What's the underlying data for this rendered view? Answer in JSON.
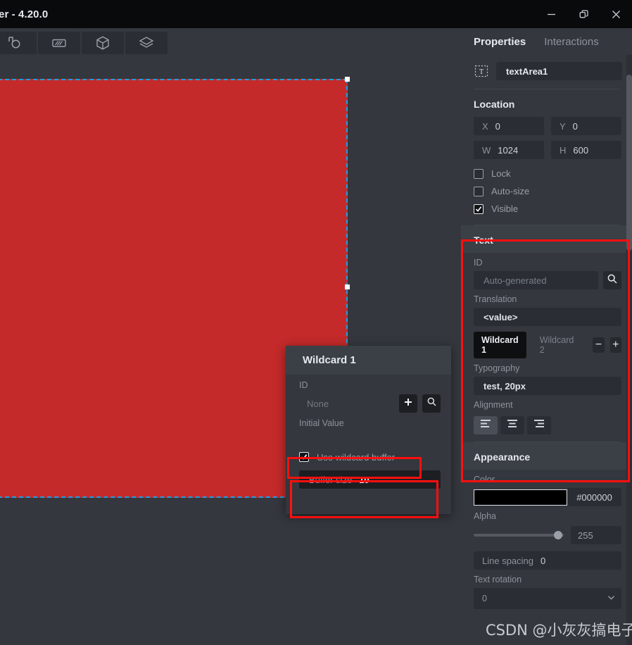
{
  "window": {
    "title": "er - 4.20.0",
    "controls": {
      "minimize": "minimize-icon",
      "restore": "restore-icon",
      "close": "close-icon"
    }
  },
  "toolbar": {
    "buttons": [
      {
        "name": "shape-tool-icon",
        "label": ""
      },
      {
        "name": "image-tool-icon",
        "label": ""
      },
      {
        "name": "box-tool-icon",
        "label": ""
      },
      {
        "name": "layers-tool-icon",
        "label": ""
      }
    ]
  },
  "canvas": {
    "selection": {
      "fill_color": "#c42a2a",
      "border_color": "#1f9fe0"
    }
  },
  "properties": {
    "tabs": [
      {
        "label": "Properties",
        "active": true
      },
      {
        "label": "Interactions",
        "active": false
      }
    ],
    "element": {
      "icon": "text-area-icon",
      "name": "textArea1"
    },
    "location": {
      "title": "Location",
      "fields": [
        {
          "label": "X",
          "value": "0"
        },
        {
          "label": "Y",
          "value": "0"
        },
        {
          "label": "W",
          "value": "1024"
        },
        {
          "label": "H",
          "value": "600"
        }
      ],
      "checkboxes": [
        {
          "label": "Lock",
          "checked": false
        },
        {
          "label": "Auto-size",
          "checked": false
        },
        {
          "label": "Visible",
          "checked": true
        }
      ]
    },
    "text": {
      "title": "Text",
      "id_label": "ID",
      "id_placeholder": "Auto-generated",
      "id_search_icon": "search-icon",
      "translation_label": "Translation",
      "translation_value": "<value>",
      "wildcards": [
        {
          "label": "Wildcard 1",
          "active": true
        },
        {
          "label": "Wildcard 2",
          "active": false
        }
      ],
      "remove_label": "−",
      "add_label": "+",
      "typography_label": "Typography",
      "typography_value": "test, 20px",
      "alignment_label": "Alignment",
      "alignment_options": [
        "align-left",
        "align-center",
        "align-right"
      ],
      "alignment_selected": "align-left"
    },
    "appearance": {
      "title": "Appearance",
      "color_label": "Color",
      "color_value": "#000000",
      "color_swatch": "#000000",
      "alpha_label": "Alpha",
      "alpha_value": "255",
      "line_spacing_label": "Line spacing",
      "line_spacing_value": "0",
      "text_rotation_label": "Text rotation",
      "text_rotation_value": "0"
    }
  },
  "wildcard_dialog": {
    "title": "Wildcard 1",
    "id_label": "ID",
    "id_value": "None",
    "add_label": "+",
    "search_icon": "search-icon",
    "initial_value_label": "Initial Value",
    "use_buffer_label": "Use wildcard buffer",
    "use_buffer_checked": true,
    "buffer_size_label": "Buffer size",
    "buffer_size_value": "10"
  },
  "annotations": {
    "color": "#ff0f0f",
    "boxes": [
      "text-section",
      "use-wildcard-buffer",
      "buffer-size"
    ]
  },
  "watermark": {
    "text": "CSDN @小灰灰搞电子"
  }
}
